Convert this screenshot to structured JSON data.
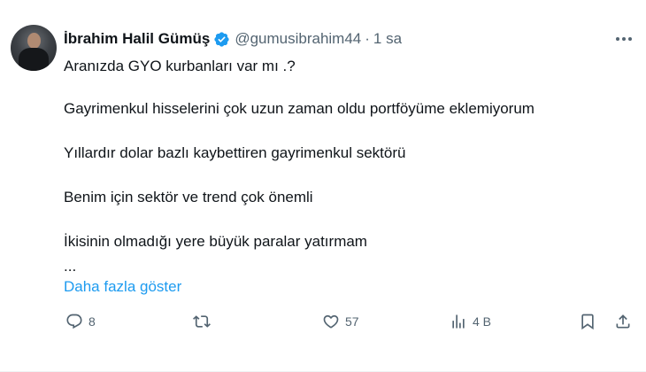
{
  "author": {
    "name": "İbrahim Halil Gümüş",
    "handle": "@gumusibrahim44",
    "separator": "·",
    "time": "1 sa",
    "verified": true
  },
  "tweet": {
    "lines": [
      "Aranızda GYO kurbanları var mı .?",
      "Gayrimenkul hisselerini çok uzun  zaman oldu portföyüme eklemiyorum",
      "Yıllardır dolar bazlı kaybettiren gayrimenkul sektörü",
      "Benim için sektör ve trend çok önemli",
      "İkisinin olmadığı yere büyük paralar yatırmam",
      "..."
    ],
    "show_more": "Daha fazla göster"
  },
  "actions": {
    "replies": "8",
    "retweets": "",
    "likes": "57",
    "views": "4 B"
  },
  "colors": {
    "accent": "#1d9bf0",
    "muted": "#536471",
    "text": "#0f1419"
  },
  "icons": [
    "verified-badge-icon",
    "more-icon",
    "reply-icon",
    "retweet-icon",
    "like-icon",
    "views-icon",
    "bookmark-icon",
    "share-icon"
  ]
}
